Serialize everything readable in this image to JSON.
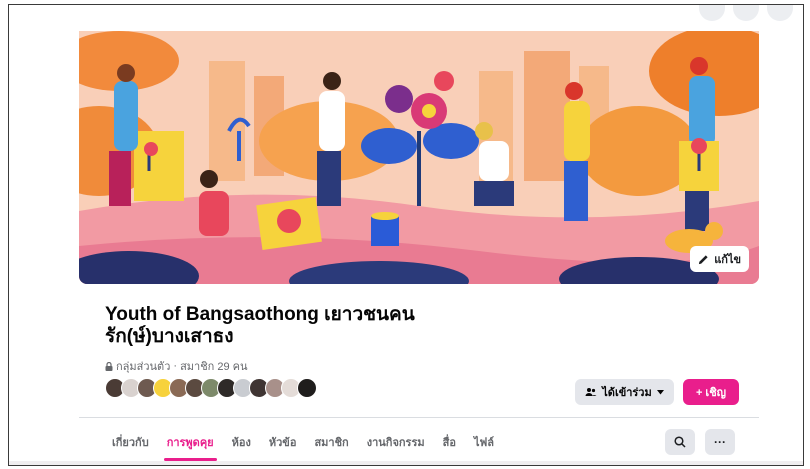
{
  "group": {
    "title": "Youth of Bangsaothong เยาวชนคนรัก(ษ์)บางเสาธง",
    "privacy": "กลุ่มส่วนตัว",
    "members": "สมาชิก 29 คน"
  },
  "cover": {
    "edit_label": "แก้ไข"
  },
  "actions": {
    "joined_label": "ได้เข้าร่วม",
    "invite_label": "+ เชิญ"
  },
  "tabs": [
    {
      "label": "เกี่ยวกับ"
    },
    {
      "label": "การพูดคุย"
    },
    {
      "label": "ห้อง"
    },
    {
      "label": "หัวข้อ"
    },
    {
      "label": "สมาชิก"
    },
    {
      "label": "งานกิจกรรม"
    },
    {
      "label": "สื่อ"
    },
    {
      "label": "ไฟล์"
    }
  ],
  "colors": {
    "accent": "#e91e8c",
    "button_gray": "#e4e6eb",
    "muted_text": "#65676b"
  },
  "icons": [
    "pencil-icon",
    "lock-icon",
    "people-icon",
    "dropdown-caret-icon",
    "search-icon",
    "more-icon"
  ]
}
